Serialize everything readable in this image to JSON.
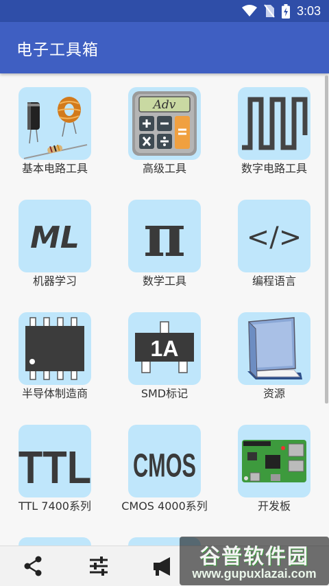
{
  "status": {
    "time": "3:03"
  },
  "app": {
    "title": "电子工具箱"
  },
  "tiles": [
    {
      "label": "基本电路工具",
      "icon": "electronic-components-icon"
    },
    {
      "label": "高级工具",
      "icon": "calculator-icon",
      "display": "Adv"
    },
    {
      "label": "数字电路工具",
      "icon": "square-wave-icon"
    },
    {
      "label": "机器学习",
      "icon": "ml-icon",
      "glyph": "ML"
    },
    {
      "label": "数学工具",
      "icon": "pi-icon",
      "glyph": "π"
    },
    {
      "label": "编程语言",
      "icon": "code-tag-icon",
      "glyph": "</>"
    },
    {
      "label": "半导体制造商",
      "icon": "ic-chip-icon"
    },
    {
      "label": "SMD标记",
      "icon": "smd-chip-icon",
      "glyph": "1A"
    },
    {
      "label": "资源",
      "icon": "book-icon"
    },
    {
      "label": "TTL 7400系列",
      "icon": "ttl-icon",
      "glyph": "TTL"
    },
    {
      "label": "CMOS 4000系列",
      "icon": "cmos-icon",
      "glyph": "CMOS"
    },
    {
      "label": "开发板",
      "icon": "dev-board-icon"
    }
  ],
  "bottom_nav": [
    {
      "icon": "share-icon"
    },
    {
      "icon": "settings-sliders-icon"
    },
    {
      "icon": "megaphone-icon"
    }
  ],
  "watermark": {
    "title": "谷普软件园",
    "url": "www.gupuxlazai.com"
  },
  "colors": {
    "status_bar": "#2f4ea8",
    "app_bar": "#3f5fc2",
    "tile_bg": "#bfe6fb",
    "icon_dark": "#333333"
  }
}
